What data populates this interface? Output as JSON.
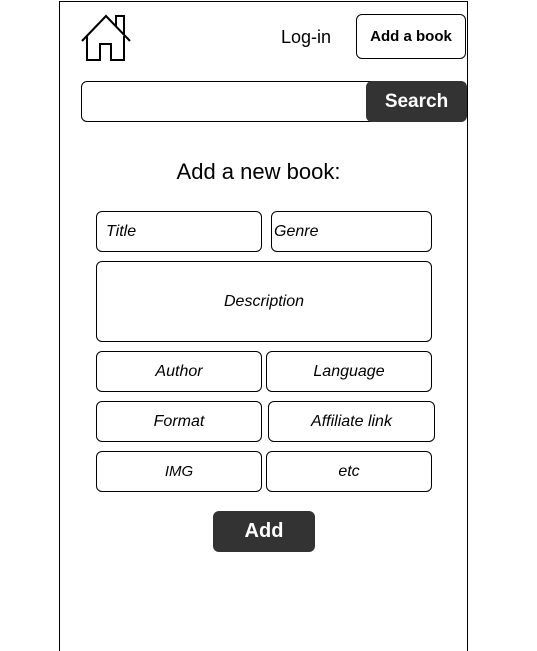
{
  "header": {
    "home_icon": "home-icon",
    "login_label": "Log-in",
    "add_book_label": "Add a book"
  },
  "search": {
    "value": "",
    "button_label": "Search"
  },
  "form": {
    "heading": "Add a new book:",
    "title_placeholder": "Title",
    "genre_placeholder": "Genre",
    "description_placeholder": "Description",
    "author_placeholder": "Author",
    "language_placeholder": "Language",
    "format_placeholder": "Format",
    "affiliate_placeholder": "Affiliate link",
    "img_placeholder": "IMG",
    "etc_placeholder": "etc",
    "submit_label": "Add"
  }
}
